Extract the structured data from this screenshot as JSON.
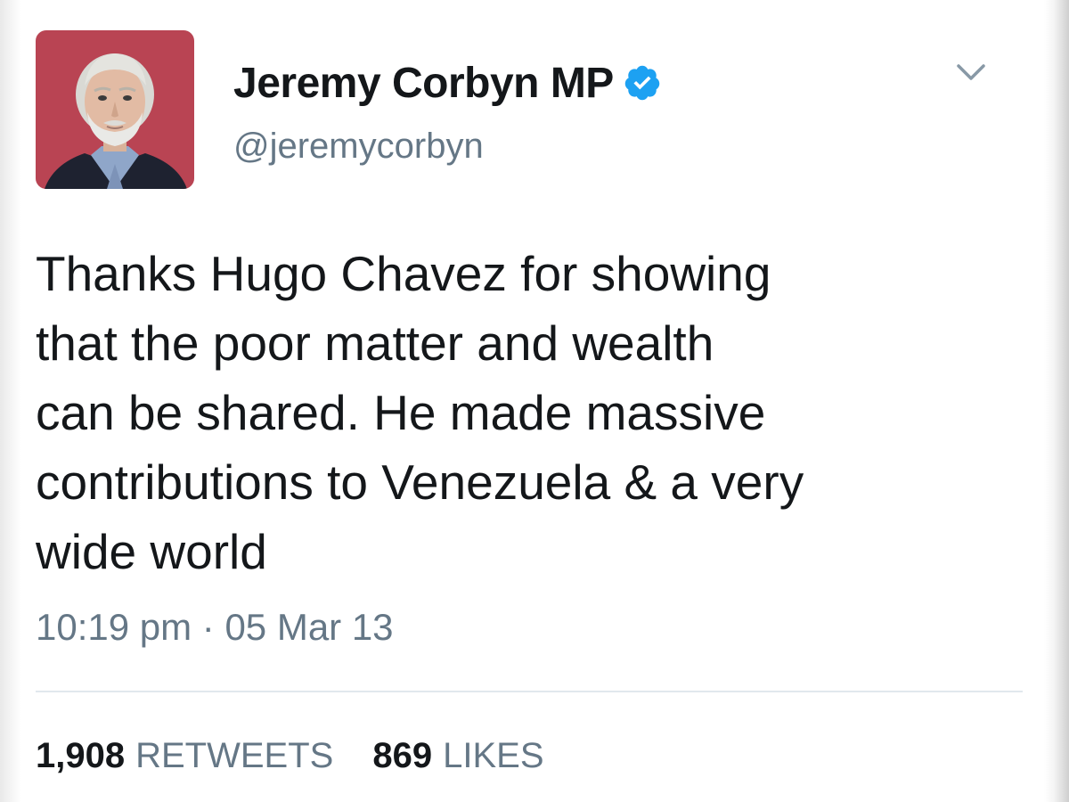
{
  "tweet": {
    "author": {
      "display_name": "Jeremy Corbyn MP",
      "handle": "@jeremycorbyn",
      "verified": true
    },
    "text": "Thanks Hugo Chavez for showing\nthat the poor matter and wealth\ncan be shared. He made massive\ncontributions to Venezuela & a very\nwide world",
    "timestamp": "10:19 pm · 05 Mar 13",
    "stats": {
      "retweets_count": "1,908",
      "retweets_label": "RETWEETS",
      "likes_count": "869",
      "likes_label": "LIKES"
    }
  },
  "icons": {
    "verified": "verified-badge-icon",
    "menu": "chevron-down-icon"
  },
  "colors": {
    "verified_blue": "#1da1f2",
    "text_primary": "#14171a",
    "text_secondary": "#657786",
    "divider": "#e1e8ed",
    "avatar_background": "#b4404f"
  }
}
